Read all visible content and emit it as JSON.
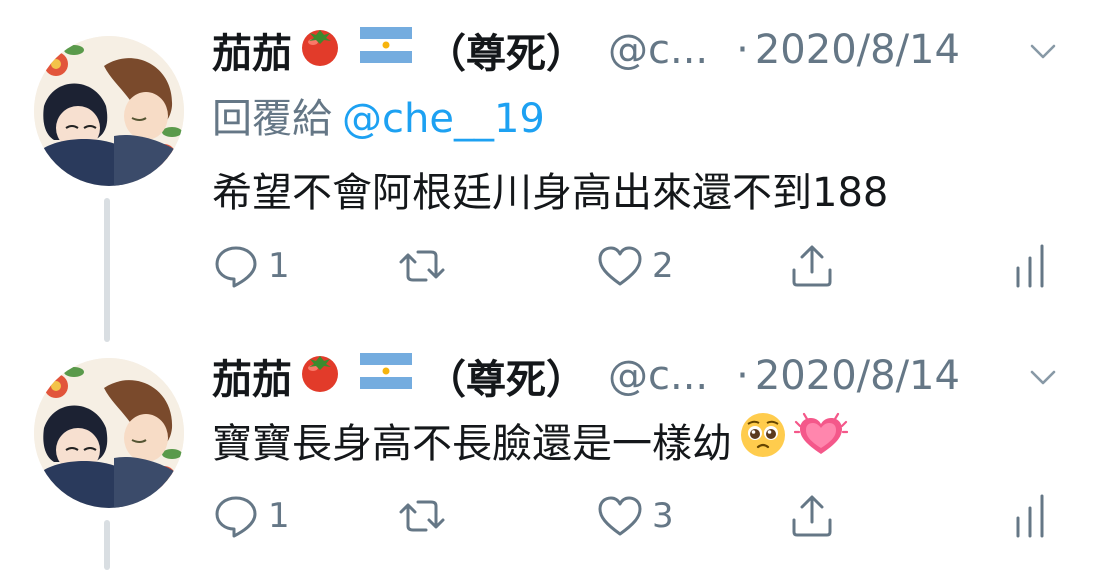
{
  "tweets": [
    {
      "author": {
        "display_name": "茄茄",
        "name_suffix": "（尊死）",
        "handle": "@c...",
        "avatar_icon": "anime-avatar-icon",
        "name_emojis": [
          "tomato-emoji",
          "argentina-flag-emoji"
        ]
      },
      "separator": "·",
      "date": "2020/8/14",
      "reply_to": {
        "label": "回覆給",
        "handle": "@che__19"
      },
      "text": "希望不會阿根廷川身高出來還不到188",
      "actions": {
        "reply_count": "1",
        "retweet_count": "",
        "like_count": "2"
      }
    },
    {
      "author": {
        "display_name": "茄茄",
        "name_suffix": "（尊死）",
        "handle": "@c...",
        "avatar_icon": "anime-avatar-icon",
        "name_emojis": [
          "tomato-emoji",
          "argentina-flag-emoji"
        ]
      },
      "separator": "·",
      "date": "2020/8/14",
      "text": "寶寶長身高不長臉還是一樣幼",
      "text_emojis": [
        "pleading-face-emoji",
        "beating-heart-emoji"
      ],
      "actions": {
        "reply_count": "1",
        "retweet_count": "",
        "like_count": "3"
      }
    }
  ],
  "colors": {
    "primary_text": "#14171a",
    "secondary_text": "#657786",
    "link": "#1da1f2",
    "thread_line": "#d9dee2"
  }
}
